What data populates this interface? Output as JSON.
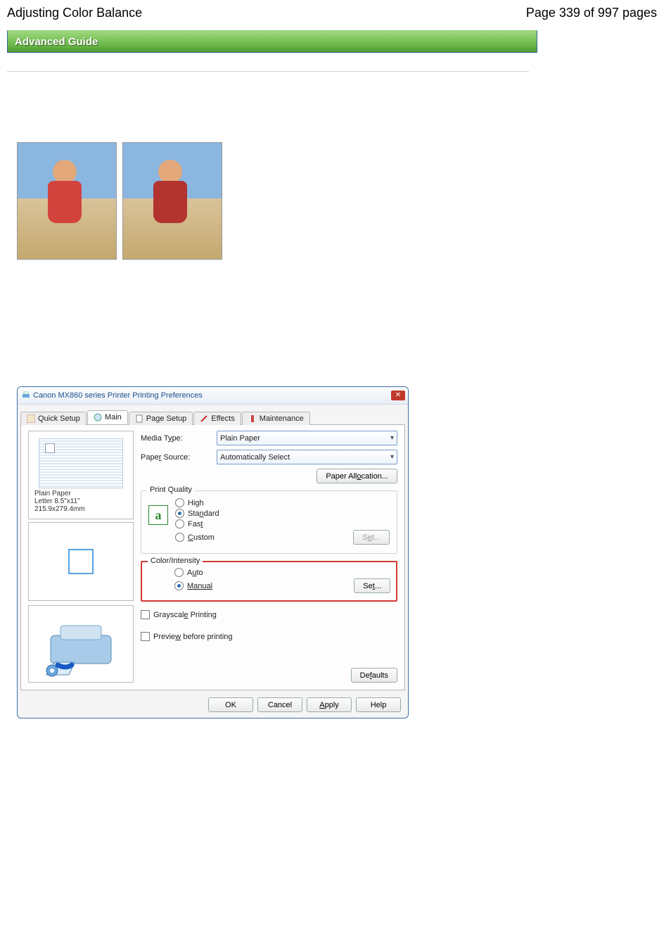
{
  "header": {
    "title": "Adjusting Color Balance",
    "pager": "Page 339 of 997 pages"
  },
  "guide": {
    "label": "Advanced Guide"
  },
  "dialog": {
    "title": "Canon MX860 series Printer Printing Preferences",
    "tabs": {
      "quick": "Quick Setup",
      "main": "Main",
      "pagesetup": "Page Setup",
      "effects": "Effects",
      "maintenance": "Maintenance"
    },
    "media_type": {
      "label": "Media Type:",
      "value": "Plain Paper"
    },
    "paper_source": {
      "label": "Paper Source:",
      "value": "Automatically Select"
    },
    "paper_alloc_btn": "Paper Allocation...",
    "print_quality": {
      "title": "Print Quality",
      "high": "High",
      "standard": "Standard",
      "fast": "Fast",
      "custom": "Custom",
      "set": "Set..."
    },
    "preview_left": {
      "line1": "Plain Paper",
      "line2": "Letter 8.5\"x11\" 215.9x279.4mm"
    },
    "color_intensity": {
      "title": "Color/Intensity",
      "auto": "Auto",
      "manual": "Manual",
      "set": "Set..."
    },
    "grayscale": "Grayscale Printing",
    "preview_before": "Preview before printing",
    "defaults": "Defaults",
    "buttons": {
      "ok": "OK",
      "cancel": "Cancel",
      "apply": "Apply",
      "help": "Help"
    }
  }
}
